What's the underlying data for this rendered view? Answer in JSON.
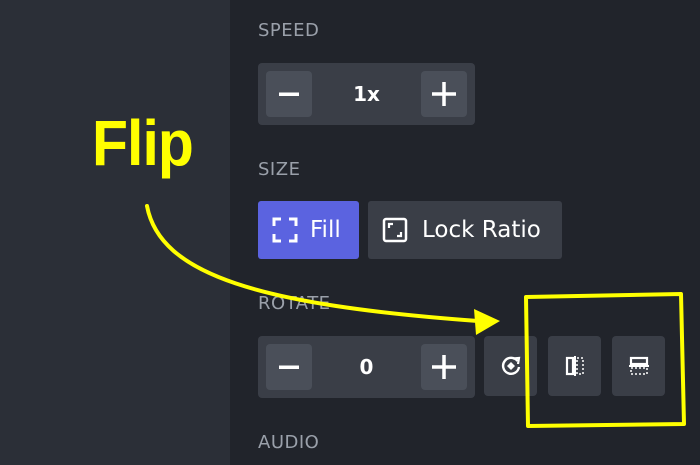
{
  "speed": {
    "label": "SPEED",
    "value": "1x"
  },
  "size": {
    "label": "SIZE",
    "fill_label": "Fill",
    "lock_ratio_label": "Lock Ratio"
  },
  "rotate": {
    "label": "ROTATE",
    "value": "0"
  },
  "audio": {
    "label": "AUDIO"
  },
  "annotation": {
    "text": "Flip"
  },
  "colors": {
    "accent": "#5b63e0",
    "annotation": "#ffff00"
  }
}
